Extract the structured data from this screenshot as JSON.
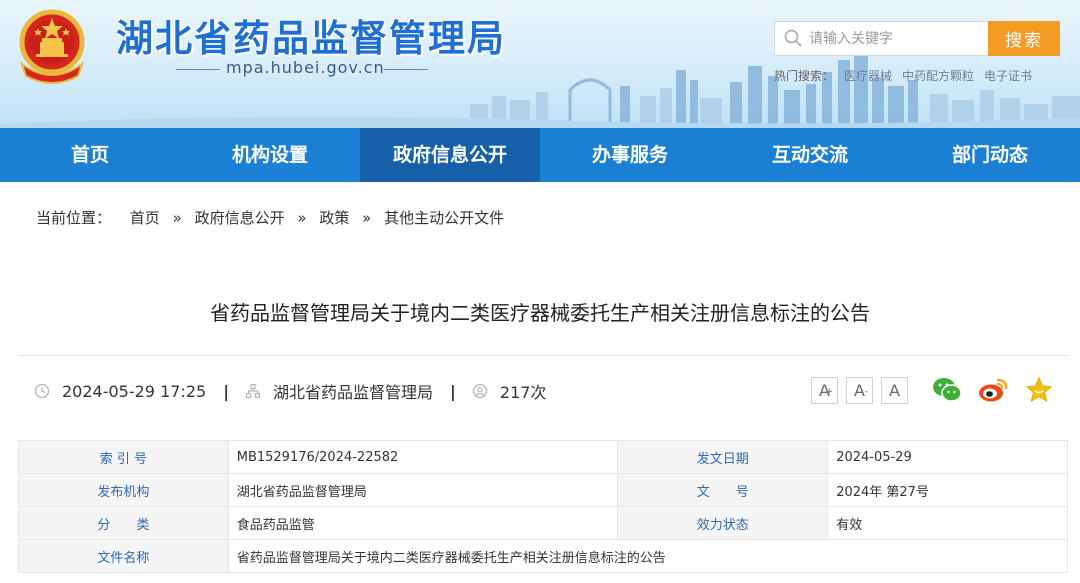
{
  "header": {
    "site_title": "湖北省药品监督管理局",
    "site_domain": "mpa.hubei.gov.cn",
    "search": {
      "placeholder": "请输入关键字",
      "button_label": "搜索"
    },
    "hot_words_label": "热门搜索：",
    "hot_words": [
      "医疗器械",
      "中药配方颗粒",
      "电子证书"
    ]
  },
  "nav": {
    "items": [
      "首页",
      "机构设置",
      "政府信息公开",
      "办事服务",
      "互动交流",
      "部门动态"
    ],
    "active_index": 2
  },
  "breadcrumb": {
    "label": "当前位置：",
    "items": [
      "首页",
      "政府信息公开",
      "政策",
      "其他主动公开文件"
    ],
    "separator": "»"
  },
  "article": {
    "title": "省药品监督管理局关于境内二类医疗器械委托生产相关注册信息标注的公告",
    "date": "2024-05-29 17:25",
    "source": "湖北省药品监督管理局",
    "views": "217次",
    "meta_separator": "|"
  },
  "tools": {
    "font_sizes": [
      "A",
      "A",
      "A"
    ],
    "font_size_marks": [
      "+",
      "-",
      ""
    ],
    "share_icons": [
      "wechat-icon",
      "weibo-icon",
      "favorite-star-icon"
    ]
  },
  "info_table": {
    "rows": [
      [
        {
          "k": "索 引 号",
          "v": "MB1529176/2024-22582"
        },
        {
          "k": "发文日期",
          "v": "2024-05-29"
        }
      ],
      [
        {
          "k": "发布机构",
          "v": "湖北省药品监督管理局"
        },
        {
          "k": "文　　号",
          "v": "2024年 第27号"
        }
      ],
      [
        {
          "k": "分　　类",
          "v": "食品药品监管"
        },
        {
          "k": "效力状态",
          "v": "有效"
        }
      ]
    ],
    "last_row": {
      "k": "文件名称",
      "v": "省药品监督管理局关于境内二类医疗器械委托生产相关注册信息标注的公告"
    }
  },
  "colors": {
    "brand_blue": "#1b7fd4",
    "nav_active": "#1560a8",
    "search_orange": "#f39b22",
    "label_blue": "#2c69b8"
  }
}
